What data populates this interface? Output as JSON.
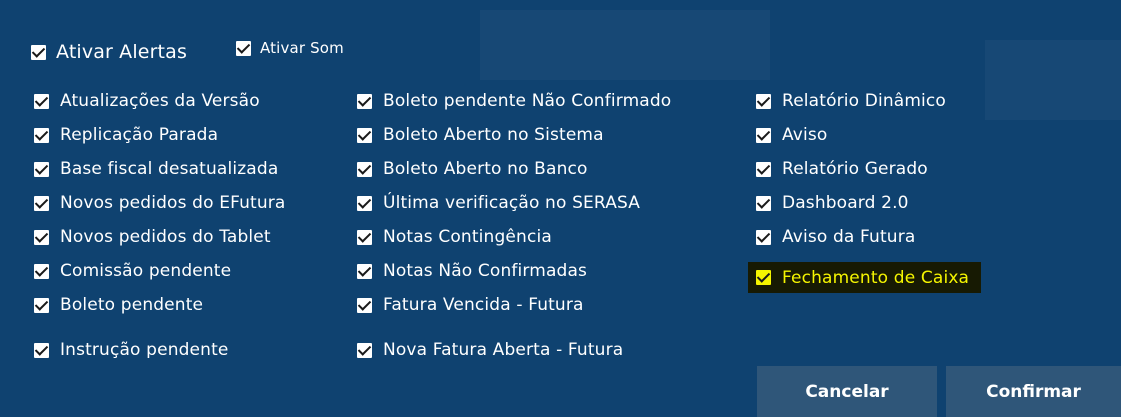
{
  "alerts": {
    "ativar_alertas": {
      "label": "Ativar Alertas",
      "checked": true
    },
    "ativar_som": {
      "label": "Ativar Som",
      "checked": true
    }
  },
  "columns": [
    {
      "items": [
        {
          "label": "Atualizações da Versão",
          "checked": true
        },
        {
          "label": "Replicação Parada",
          "checked": true
        },
        {
          "label": "Base fiscal desatualizada",
          "checked": true
        },
        {
          "label": "Novos pedidos do EFutura",
          "checked": true
        },
        {
          "label": "Novos pedidos do Tablet",
          "checked": true
        },
        {
          "label": "Comissão pendente",
          "checked": true
        },
        {
          "label": "Boleto pendente",
          "checked": true
        },
        {
          "label": "Instrução pendente",
          "checked": true
        }
      ]
    },
    {
      "items": [
        {
          "label": "Boleto pendente Não Confirmado",
          "checked": true
        },
        {
          "label": "Boleto Aberto no Sistema",
          "checked": true
        },
        {
          "label": "Boleto Aberto no Banco",
          "checked": true
        },
        {
          "label": "Última verificação no SERASA",
          "checked": true
        },
        {
          "label": "Notas Contingência",
          "checked": true
        },
        {
          "label": "Notas Não Confirmadas",
          "checked": true
        },
        {
          "label": "Fatura Vencida - Futura",
          "checked": true
        },
        {
          "label": "Nova Fatura Aberta - Futura",
          "checked": true
        }
      ]
    },
    {
      "items": [
        {
          "label": "Relatório Dinâmico",
          "checked": true
        },
        {
          "label": "Aviso",
          "checked": true
        },
        {
          "label": "Relatório Gerado",
          "checked": true
        },
        {
          "label": "Dashboard 2.0",
          "checked": true
        },
        {
          "label": "Aviso da Futura",
          "checked": true
        },
        {
          "label": "Fechamento de Caixa",
          "checked": true,
          "highlighted": true
        }
      ]
    }
  ],
  "buttons": {
    "cancel": "Cancelar",
    "confirm": "Confirmar"
  },
  "colors": {
    "background": "#0f4270",
    "button": "#2f5679",
    "highlight_text": "#f5f500",
    "highlight_bg": "#171a03"
  }
}
